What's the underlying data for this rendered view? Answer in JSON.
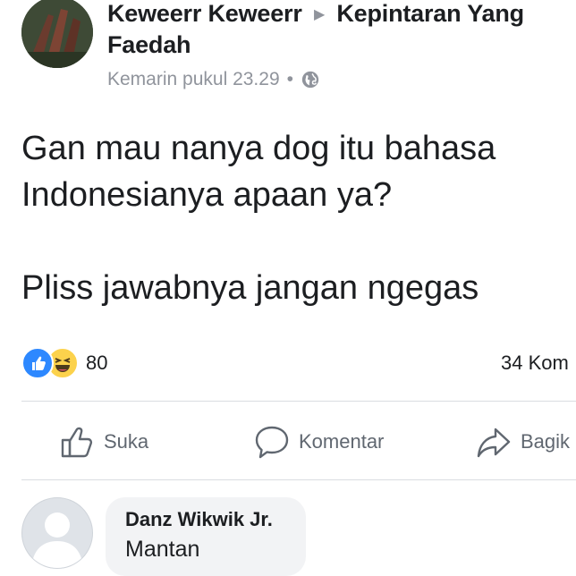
{
  "post": {
    "author": "Keweerr Keweerr",
    "arrow": "▶",
    "group": "Kepintaran Yang Faedah",
    "timestamp": "Kemarin pukul 23.29",
    "separator": "•",
    "privacy_icon": "globe-icon",
    "paragraphs": [
      "Gan mau nanya dog itu bahasa Indonesianya apaan ya?",
      "Pliss jawabnya jangan ngegas"
    ]
  },
  "stats": {
    "reactions": [
      "like-reaction",
      "haha-reaction"
    ],
    "reaction_count": "80",
    "comment_count": "34 Kom"
  },
  "actions": {
    "like_label": "Suka",
    "comment_label": "Komentar",
    "share_label": "Bagik"
  },
  "comment": {
    "author": "Danz Wikwik Jr.",
    "text": "Mantan"
  },
  "colors": {
    "like_blue": "#2d88ff",
    "haha_yellow": "#fcd24c",
    "secondary_text": "#90949c",
    "bubble_bg": "#f2f3f5"
  }
}
